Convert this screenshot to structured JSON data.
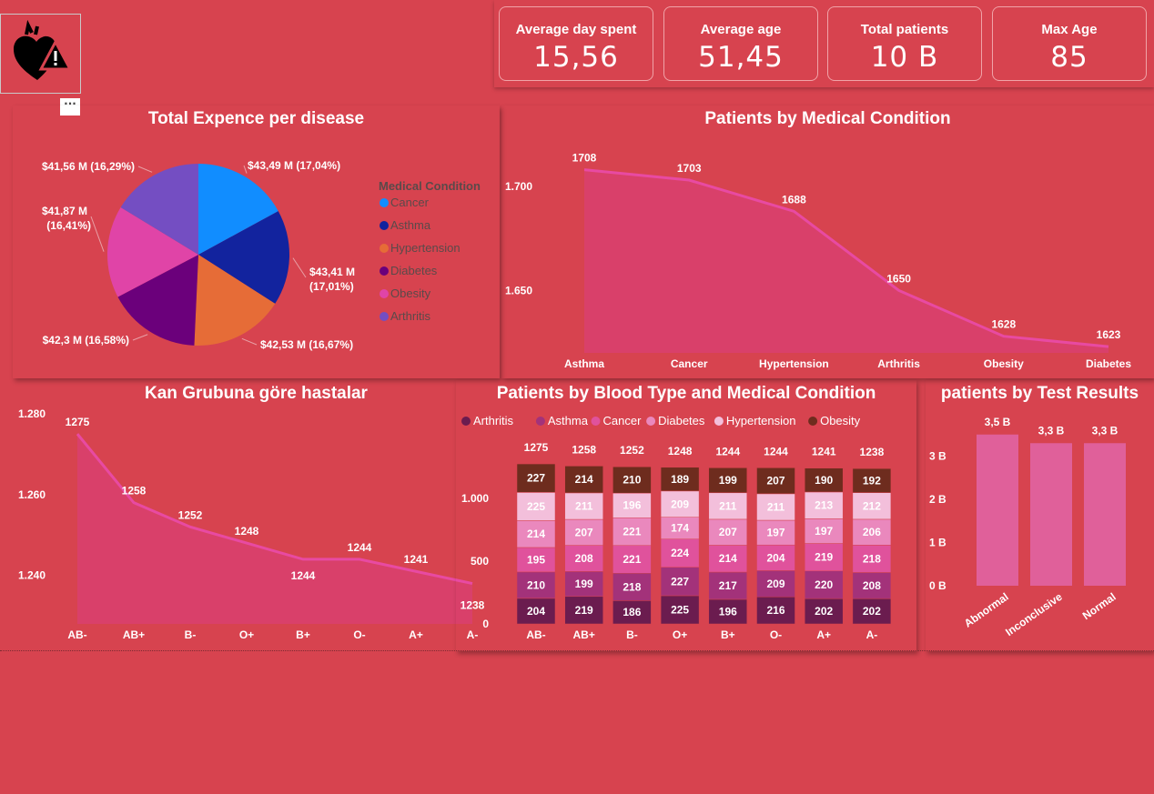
{
  "kpis": [
    {
      "label": "Average day spent",
      "value": "15,56"
    },
    {
      "label": "Average age",
      "value": "51,45"
    },
    {
      "label": "Total patients",
      "value": "10 B"
    },
    {
      "label": "Max Age",
      "value": "85"
    }
  ],
  "more_label": "···",
  "colors": {
    "background": "#d7434f",
    "area_fill": "#d9406a",
    "area_line": "#e84aa2",
    "bar_pink": "#e0609a"
  },
  "chart_data": [
    {
      "type": "pie",
      "title": "Total Expence per disease",
      "legend_title": "Medical Condition",
      "legend_position": "right",
      "slices": [
        {
          "name": "Cancer",
          "value": 43.49,
          "label": "$43,49 M (17,04%)",
          "color": "#118dff"
        },
        {
          "name": "Asthma",
          "value": 43.41,
          "label": "$43,41 M (17,01%)",
          "color": "#12239e"
        },
        {
          "name": "Hypertension",
          "value": 42.53,
          "label": "$42,53 M (16,67%)",
          "color": "#e66c37"
        },
        {
          "name": "Diabetes",
          "value": 42.3,
          "label": "$42,3 M (16,58%)",
          "color": "#6b007b"
        },
        {
          "name": "Obesity",
          "value": 41.87,
          "label": "$41,87 M (16,41%)",
          "color": "#e044a7"
        },
        {
          "name": "Arthritis",
          "value": 41.56,
          "label": "$41,56 M (16,29%)",
          "color": "#744ec2"
        }
      ]
    },
    {
      "type": "area",
      "title": "Patients by Medical Condition",
      "categories": [
        "Asthma",
        "Cancer",
        "Hypertension",
        "Arthritis",
        "Obesity",
        "Diabetes"
      ],
      "values": [
        1708,
        1703,
        1688,
        1650,
        1628,
        1623
      ],
      "yticks": [
        "1.700",
        "1.650"
      ],
      "ylim": [
        1620,
        1710
      ]
    },
    {
      "type": "area",
      "title": "Kan Grubuna göre hastalar",
      "categories": [
        "AB-",
        "AB+",
        "B-",
        "O+",
        "B+",
        "O-",
        "A+",
        "A-"
      ],
      "values": [
        1275,
        1258,
        1252,
        1248,
        1244,
        1244,
        1241,
        1238
      ],
      "yticks": [
        "1.280",
        "1.260",
        "1.240"
      ],
      "ylim": [
        1228,
        1282
      ]
    },
    {
      "type": "bar",
      "stacked": true,
      "title": "Patients by Blood Type and Medical Condition",
      "legend_position": "top",
      "categories": [
        "AB-",
        "AB+",
        "B-",
        "O+",
        "B+",
        "O-",
        "A+",
        "A-"
      ],
      "totals": [
        1275,
        1258,
        1252,
        1248,
        1244,
        1244,
        1241,
        1238
      ],
      "yticks": [
        "1.000",
        "500",
        "0"
      ],
      "ylim": [
        0,
        1300
      ],
      "series": [
        {
          "name": "Arthritis",
          "color": "#6b1c4f",
          "values": [
            204,
            219,
            186,
            225,
            196,
            216,
            202,
            202
          ]
        },
        {
          "name": "Asthma",
          "color": "#a3327a",
          "values": [
            210,
            199,
            218,
            227,
            217,
            209,
            220,
            208
          ]
        },
        {
          "name": "Cancer",
          "color": "#e0529c",
          "values": [
            195,
            208,
            221,
            224,
            214,
            204,
            219,
            218
          ]
        },
        {
          "name": "Diabetes",
          "color": "#ea88bd",
          "values": [
            214,
            207,
            221,
            174,
            207,
            197,
            197,
            206
          ]
        },
        {
          "name": "Hypertension",
          "color": "#f3bfdb",
          "values": [
            225,
            211,
            196,
            209,
            211,
            211,
            213,
            212
          ]
        },
        {
          "name": "Obesity",
          "color": "#6e2c1e",
          "values": [
            227,
            214,
            210,
            189,
            199,
            207,
            190,
            192
          ]
        }
      ]
    },
    {
      "type": "bar",
      "title": "patients by Test Results",
      "categories": [
        "Abnormal",
        "Inconclusive",
        "Normal"
      ],
      "values": [
        3.5,
        3.3,
        3.3
      ],
      "data_labels": [
        "3,5 B",
        "3,3 B",
        "3,3 B"
      ],
      "yticks": [
        "3 B",
        "2 B",
        "1 B",
        "0 B"
      ],
      "ylim": [
        0,
        3.6
      ]
    }
  ]
}
